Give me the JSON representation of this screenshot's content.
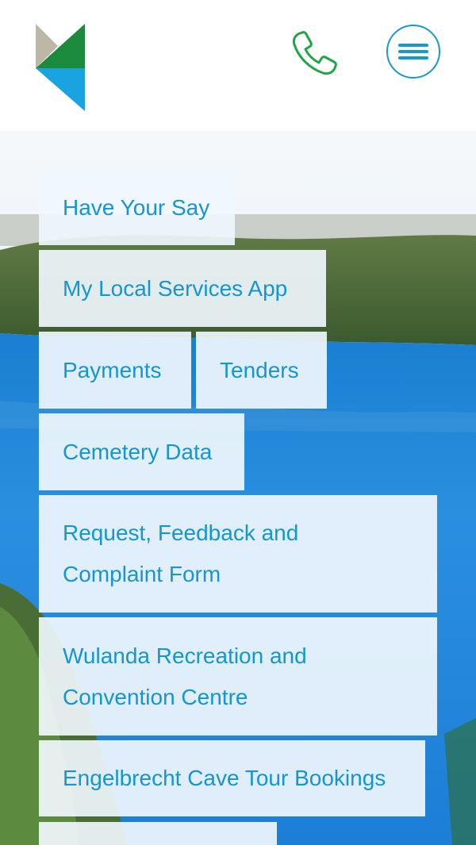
{
  "header": {
    "logo_name": "council-logo",
    "phone_icon": "phone-icon",
    "menu_icon": "hamburger-menu-icon"
  },
  "colors": {
    "accent_blue": "#1599d4",
    "phone_green": "#1fa447",
    "logo_beige": "#bdb7a6",
    "logo_green": "#1b8a3c",
    "logo_blue": "#1aa3e0",
    "tile_text": "#1596d2"
  },
  "quick_links": [
    {
      "label": "Have Your Say"
    },
    {
      "label": "My Local Services App"
    },
    {
      "label": "Payments"
    },
    {
      "label": "Tenders"
    },
    {
      "label": "Cemetery Data"
    },
    {
      "label": "Request, Feedback and Complaint Form"
    },
    {
      "label": "Wulanda Recreation and Convention Centre"
    },
    {
      "label": "Engelbrecht Cave Tour Bookings"
    }
  ]
}
